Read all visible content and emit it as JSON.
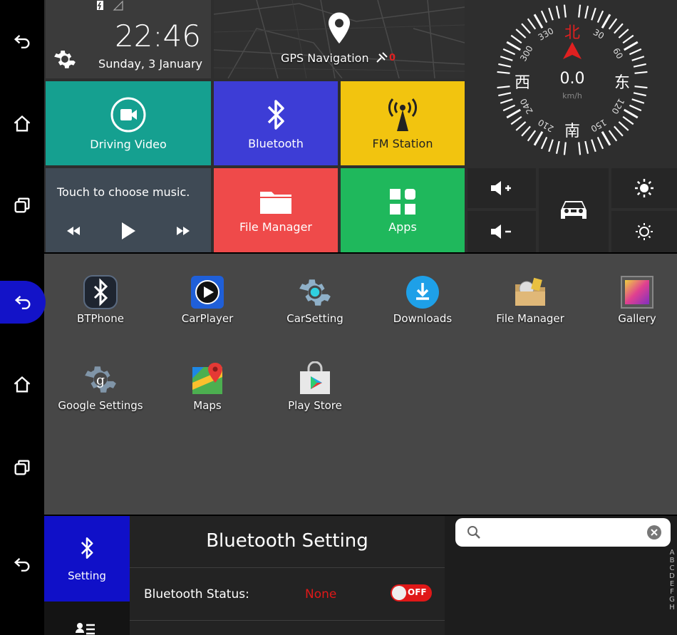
{
  "home": {
    "clock": {
      "time": "22:46",
      "date": "Sunday, 3 January"
    },
    "gps": {
      "label": "GPS Navigation",
      "gps_count": "0"
    },
    "compass": {
      "north": "北",
      "south": "南",
      "east": "东",
      "west": "西",
      "speed": "0.0",
      "unit": "km/h",
      "degrees": [
        "30",
        "60",
        "120",
        "150",
        "210",
        "240",
        "300",
        "330"
      ]
    },
    "tiles": {
      "driving_video": "Driving Video",
      "bluetooth": "Bluetooth",
      "fm_station": "FM Station",
      "file_manager": "File Manager",
      "apps": "Apps"
    },
    "music": {
      "prompt": "Touch to choose music."
    },
    "colors": {
      "driving_video": "#15a090",
      "bluetooth": "#3d3dd6",
      "fm_station": "#f2c40f",
      "file_manager": "#ef4a4a",
      "apps": "#1fb85c",
      "music": "#3f4a55"
    }
  },
  "apps": {
    "row1": [
      "BTPhone",
      "CarPlayer",
      "CarSetting",
      "Downloads",
      "File Manager",
      "Gallery"
    ],
    "row2": [
      "Google Settings",
      "Maps",
      "Play Store"
    ]
  },
  "bt": {
    "tab_label": "Setting",
    "title": "Bluetooth Setting",
    "status_label": "Bluetooth Status:",
    "status_value": "None",
    "toggle": "OFF",
    "status_color": "#e01818",
    "alphabet": [
      "A",
      "B",
      "C",
      "D",
      "E",
      "F",
      "G",
      "H"
    ]
  }
}
